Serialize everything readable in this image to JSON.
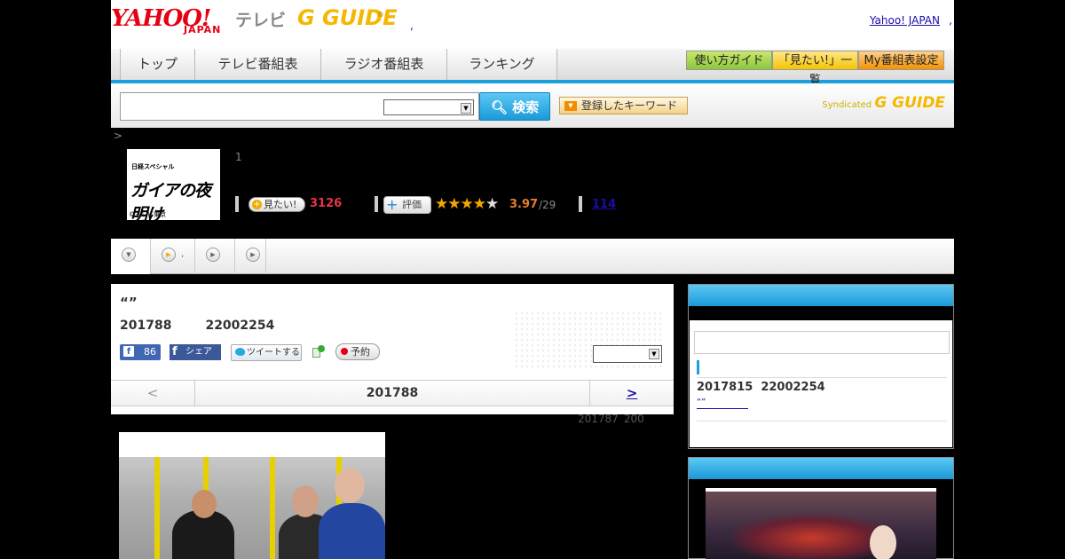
{
  "header": {
    "yahoo_logo": "YAHOO!",
    "yahoo_sub": "JAPAN",
    "tv_logo": "テレビ",
    "gguide_logo": "G GUIDE",
    "gguide_mark": "®",
    "dot": ",",
    "yahoo_japan_link": "Yahoo! JAPAN",
    "comma": ","
  },
  "nav": {
    "tabs": [
      "トップ",
      "テレビ番組表",
      "ラジオ番組表",
      "ランキング"
    ],
    "buttons": [
      "使い方ガイド",
      "「見たい!」一覧",
      "My番組表設定"
    ]
  },
  "search": {
    "button_label": "検索",
    "keyword_button": "登録したキーワード",
    "syndicated": "Syndicated",
    "syndicated_brand": "G GUIDE"
  },
  "breadcrumb": ">",
  "program": {
    "image_text_top": "日経スペシャル",
    "image_title": "ガイアの夜明け",
    "image_credit": "©テレビ東京",
    "number": "1",
    "mitai_label": "見たい!",
    "mitai_count": "3126",
    "hyoka_label": "評価",
    "stars_filled": 3.97,
    "rating": "3.97",
    "rating_count": "/29",
    "review_count": "114"
  },
  "subtabs": {
    "second_dot": ","
  },
  "episode": {
    "quote": "“”",
    "date": "201788",
    "time": "22002254",
    "fb_like_count": "86",
    "fb_share_label": "シェア",
    "tweet_label": "ツイートする",
    "yoyaku_label": "予約",
    "pager_prev": "<",
    "pager_date": "201788",
    "pager_next": ">"
  },
  "note": {
    "date": "201787",
    "time": "200"
  },
  "sidebar": {
    "date": "2017815",
    "time": "22002254",
    "link": "“”"
  },
  "colors": {
    "accent_blue": "#1aa0dc",
    "yahoo_red": "#e60012",
    "gguide_yellow": "#f4b800",
    "mitai_pink": "#e8324a",
    "rating_orange": "#e87d2d",
    "link_blue": "#1a0dab"
  }
}
